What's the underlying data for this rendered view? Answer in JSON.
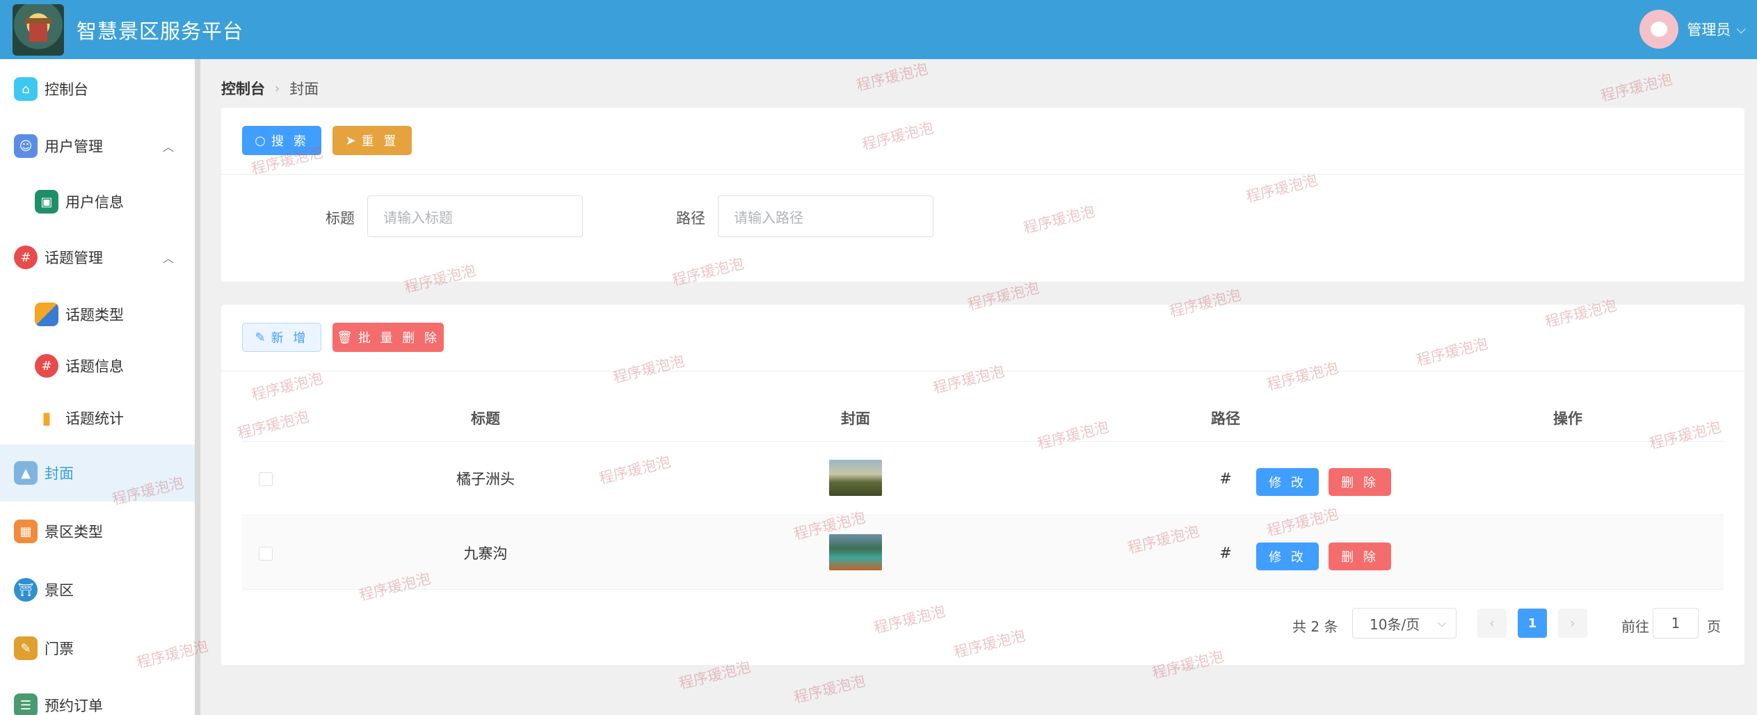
{
  "header": {
    "title": "智慧景区服务平台",
    "user": "管理员"
  },
  "sidebar": {
    "items": [
      {
        "label": "控制台",
        "icon": "home-icon",
        "color": "#3ec7f0"
      },
      {
        "label": "用户管理",
        "icon": "user-group-icon",
        "color": "#5b8de8"
      },
      {
        "label": "用户信息",
        "icon": "user-card-icon",
        "color": "#1f8f6a"
      },
      {
        "label": "话题管理",
        "icon": "hash-icon",
        "color": "#e84b4b"
      },
      {
        "label": "话题类型",
        "icon": "blocks-icon",
        "color": "#f5a623"
      },
      {
        "label": "话题信息",
        "icon": "hash-icon",
        "color": "#e84b4b"
      },
      {
        "label": "话题统计",
        "icon": "bar-chart-icon",
        "color": "#f5a623"
      },
      {
        "label": "封面",
        "icon": "image-icon",
        "color": "#7fb4e0"
      },
      {
        "label": "景区类型",
        "icon": "grid-icon",
        "color": "#f08c3c"
      },
      {
        "label": "景区",
        "icon": "landmark-icon",
        "color": "#2f8fd1"
      },
      {
        "label": "门票",
        "icon": "ticket-icon",
        "color": "#e0a030"
      },
      {
        "label": "预约订单",
        "icon": "order-icon",
        "color": "#4a9a70"
      }
    ]
  },
  "breadcrumb": {
    "home": "控制台",
    "current": "封面"
  },
  "search_card": {
    "search_label": "搜 索",
    "reset_label": "重 置",
    "title_label": "标题",
    "title_placeholder": "请输入标题",
    "path_label": "路径",
    "path_placeholder": "请输入路径"
  },
  "table_card": {
    "add_label": "新 增",
    "batch_delete_label": "批 量 删 除",
    "columns": [
      "标题",
      "封面",
      "路径",
      "操作"
    ],
    "rows": [
      {
        "title": "橘子洲头",
        "path": "#",
        "edit": "修 改",
        "delete": "删 除"
      },
      {
        "title": "九寨沟",
        "path": "#",
        "edit": "修 改",
        "delete": "删 除"
      }
    ],
    "pagination": {
      "total": "共 2 条",
      "page_size": "10条/页",
      "current_page": "1",
      "goto_label": "前往",
      "goto_value": "1",
      "page_suffix": "页"
    }
  },
  "watermark": "程序瑗泡泡"
}
